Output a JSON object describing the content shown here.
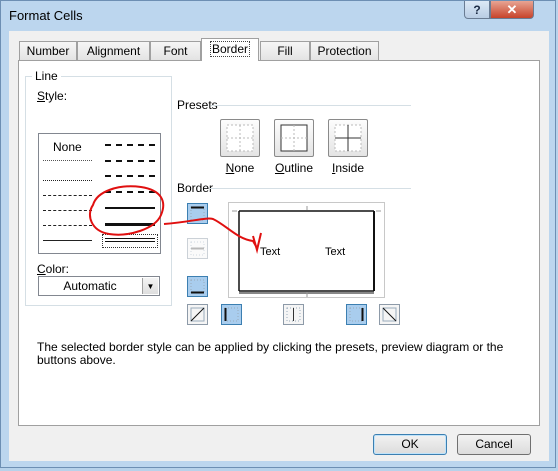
{
  "window": {
    "title": "Format Cells",
    "help_label": "?",
    "close_label": "✕"
  },
  "tabs": [
    {
      "label": "Number",
      "active": false
    },
    {
      "label": "Alignment",
      "active": false
    },
    {
      "label": "Font",
      "active": false
    },
    {
      "label": "Border",
      "active": true
    },
    {
      "label": "Fill",
      "active": false
    },
    {
      "label": "Protection",
      "active": false
    }
  ],
  "line": {
    "group_label": "Line",
    "style_label": "Style:",
    "style_none": "None",
    "color_label": "Color:",
    "color_value": "Automatic"
  },
  "presets": {
    "group_label": "Presets",
    "none": "None",
    "outline": "Outline",
    "inside": "Inside"
  },
  "border": {
    "group_label": "Border",
    "preview_text_left": "Text",
    "preview_text_right": "Text"
  },
  "description": "The selected border style can be applied by clicking the presets, preview diagram or the buttons above.",
  "buttons": {
    "ok": "OK",
    "cancel": "Cancel"
  },
  "colors": {
    "annotation": "#e01010",
    "selected_button": "#a9cdee",
    "accent": "#3c7fb1"
  }
}
